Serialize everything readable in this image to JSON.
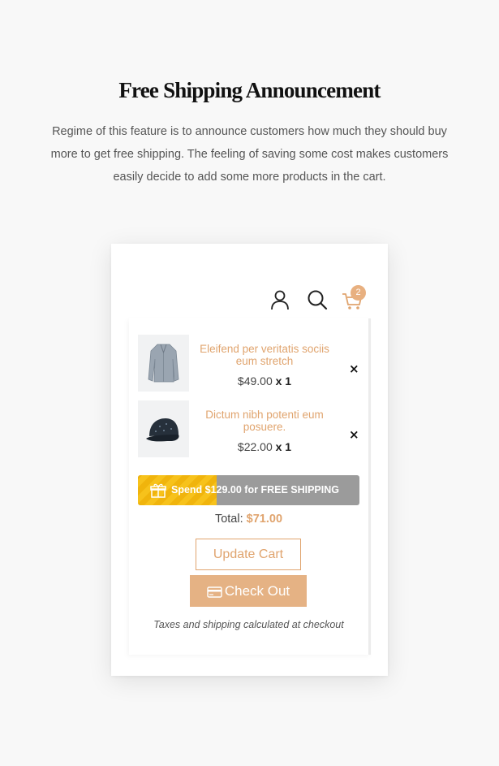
{
  "page": {
    "title": "Free Shipping Announcement",
    "description": "Regime of this feature is to announce customers how much they should buy more to get free shipping. The feeling of saving some cost makes customers easily decide to add some more products in the cart."
  },
  "header": {
    "icons": [
      "user-icon",
      "search-icon",
      "cart-icon"
    ],
    "cart_count": "2"
  },
  "cart": {
    "items": [
      {
        "name": "Eleifend per veritatis sociis eum stretch",
        "price": "$49.00",
        "qty": "x 1",
        "thumb": "coat-thumbnail",
        "remove": "×"
      },
      {
        "name": "Dictum nibh potenti eum posuere.",
        "price": "$22.00",
        "qty": "x 1",
        "thumb": "cap-thumbnail",
        "remove": "×"
      }
    ],
    "shipping": {
      "message": "Spend $129.00 for FREE SHIPPING",
      "progress": 0.355,
      "icon": "gift-icon"
    },
    "total_label": "Total:",
    "total_value": "$71.00",
    "update_label": "Update Cart",
    "checkout_label": "Check Out",
    "tax_note": "Taxes and shipping calculated at checkout"
  },
  "colors": {
    "accent": "#e0a46e",
    "progress_fill": "#f7c21b",
    "progress_track": "#9b9b9b"
  }
}
